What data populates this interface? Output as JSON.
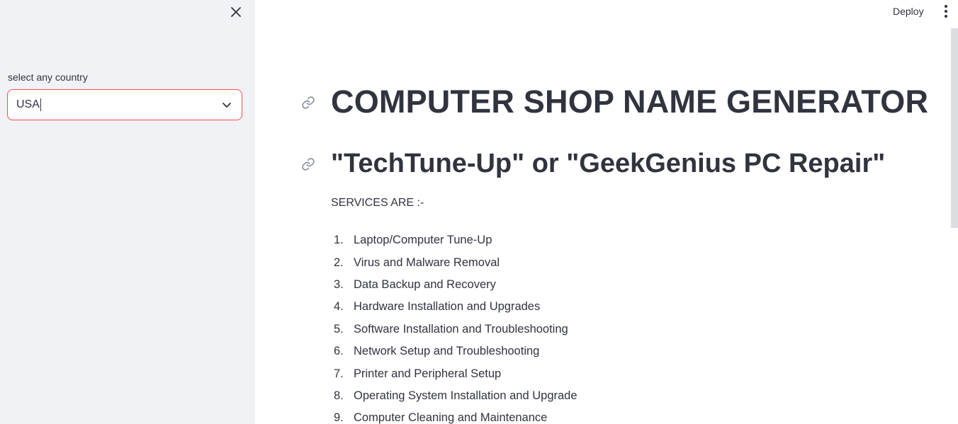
{
  "sidebar": {
    "select_label": "select any country",
    "select_value": "USA"
  },
  "header": {
    "deploy_label": "Deploy"
  },
  "main": {
    "title": "COMPUTER SHOP NAME GENERATOR",
    "subtitle": "\"TechTune-Up\" or \"GeekGenius PC Repair\"",
    "services_heading": "SERVICES ARE :-",
    "services": [
      {
        "num": "1.",
        "label": "Laptop/Computer Tune-Up"
      },
      {
        "num": "2.",
        "label": "Virus and Malware Removal"
      },
      {
        "num": "3.",
        "label": "Data Backup and Recovery"
      },
      {
        "num": "4.",
        "label": "Hardware Installation and Upgrades"
      },
      {
        "num": "5.",
        "label": "Software Installation and Troubleshooting"
      },
      {
        "num": "6.",
        "label": "Network Setup and Troubleshooting"
      },
      {
        "num": "7.",
        "label": "Printer and Peripheral Setup"
      },
      {
        "num": "8.",
        "label": "Operating System Installation and Upgrade"
      },
      {
        "num": "9.",
        "label": "Computer Cleaning and Maintenance"
      }
    ]
  },
  "colors": {
    "accent": "#ff4b4b",
    "sidebar_bg": "#f0f2f6",
    "text": "#31333f"
  },
  "icons": {
    "close": "close-icon",
    "chevron": "chevron-down-icon",
    "menu": "more-vertical-icon",
    "link": "link-icon"
  }
}
